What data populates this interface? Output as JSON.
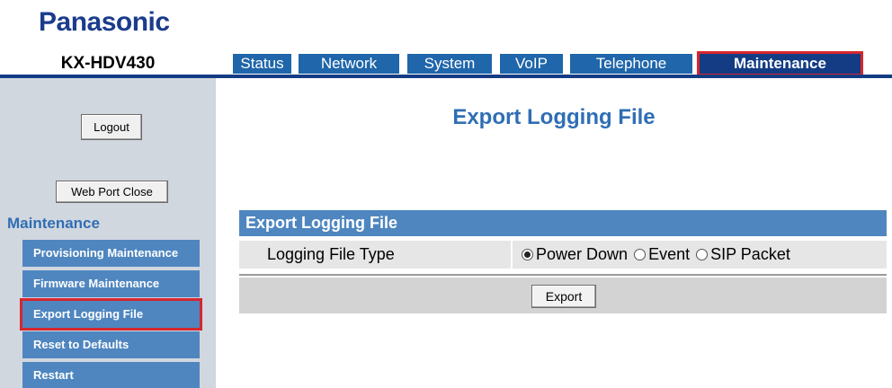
{
  "brand": {
    "logo_text": "Panasonic",
    "color": "#1b3b8c"
  },
  "model": "KX-HDV430",
  "tabs": [
    {
      "label": "Status",
      "active": false
    },
    {
      "label": "Network",
      "active": false
    },
    {
      "label": "System",
      "active": false
    },
    {
      "label": "VoIP",
      "active": false
    },
    {
      "label": "Telephone",
      "active": false
    },
    {
      "label": "Maintenance",
      "active": true
    }
  ],
  "sidebar": {
    "logout_label": "Logout",
    "web_port_close_label": "Web Port Close",
    "section_heading": "Maintenance",
    "items": [
      {
        "label": "Provisioning Maintenance",
        "active": false
      },
      {
        "label": "Firmware Maintenance",
        "active": false
      },
      {
        "label": "Export Logging File",
        "active": true
      },
      {
        "label": "Reset to Defaults",
        "active": false
      },
      {
        "label": "Restart",
        "active": false
      }
    ]
  },
  "main": {
    "page_title": "Export Logging File",
    "section_title": "Export Logging File",
    "field_label": "Logging File Type",
    "options": [
      {
        "label": "Power Down",
        "checked": true
      },
      {
        "label": "Event",
        "checked": false
      },
      {
        "label": "SIP Packet",
        "checked": false
      }
    ],
    "export_label": "Export"
  },
  "colors": {
    "tab_blue": "#1f66aa",
    "tab_active": "#133c84",
    "highlight_red": "#d7262e",
    "sidebar_bg": "#d1d7de",
    "item_blue": "#4f86c0",
    "heading_blue": "#2f6eb4"
  }
}
